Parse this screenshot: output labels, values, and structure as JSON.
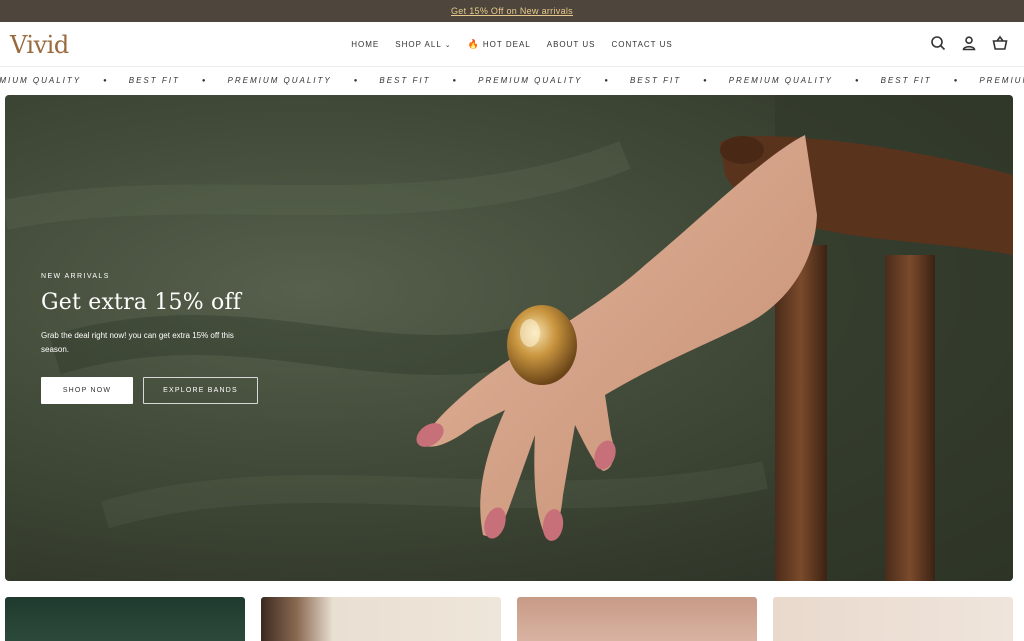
{
  "announcement": {
    "text": "Get 15% Off on New arrivals"
  },
  "header": {
    "logo": "Vivid",
    "nav": [
      {
        "label": "HOME"
      },
      {
        "label": "SHOP ALL",
        "has_dropdown": true
      },
      {
        "label": "HOT DEAL",
        "icon": "fire-icon"
      },
      {
        "label": "ABOUT US"
      },
      {
        "label": "CONTACT US"
      }
    ],
    "icons": [
      "search-icon",
      "account-icon",
      "cart-icon"
    ]
  },
  "marquee": {
    "items": [
      "EMIUM QUALITY",
      "BEST FIT",
      "PREMIUM QUALITY",
      "BEST FIT",
      "PREMIUM QUALITY",
      "BEST FIT",
      "PREMIUM QUALITY",
      "BEST FIT",
      "PREMIUM"
    ]
  },
  "hero": {
    "kicker": "NEW ARRIVALS",
    "title": "Get extra 15% off",
    "subtitle": "Grab the deal right now! you can get extra 15% off this season.",
    "primary_button": "SHOP NOW",
    "secondary_button": "EXPLORE BANDS"
  },
  "colors": {
    "announcement_bg": "#4e463c",
    "announcement_text": "#e8c98c",
    "brand": "#9a6a3f",
    "hot_deal": "#e8722a"
  }
}
